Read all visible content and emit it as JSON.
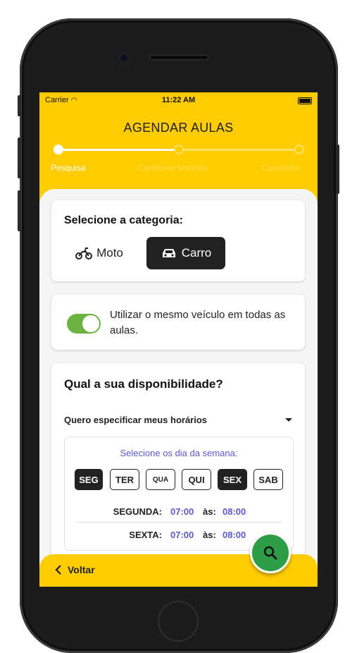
{
  "status_bar": {
    "carrier": "Carrier",
    "time": "11:22 AM"
  },
  "header": {
    "title": "AGENDAR AULAS"
  },
  "stepper": {
    "steps": [
      {
        "label": "Pesquisa",
        "active": true
      },
      {
        "label": "Confirmar horários",
        "active": false
      },
      {
        "label": "Concluído",
        "active": false
      }
    ]
  },
  "category": {
    "title": "Selecione a categoria:",
    "options": [
      {
        "label": "Moto",
        "icon": "motorcycle-icon",
        "selected": false
      },
      {
        "label": "Carro",
        "icon": "car-icon",
        "selected": true
      }
    ]
  },
  "same_vehicle": {
    "text": "Utilizar o mesmo veículo em todas as aulas.",
    "enabled": true
  },
  "availability": {
    "title": "Qual a sua disponibilidade?",
    "mode": "Quero especificar meus horários",
    "weekday_prompt": "Selecione os dia da semana:",
    "days": [
      {
        "label": "SEG",
        "selected": true
      },
      {
        "label": "TER",
        "selected": false
      },
      {
        "label": "QUA",
        "selected": false
      },
      {
        "label": "QUI",
        "selected": false
      },
      {
        "label": "SEX",
        "selected": true
      },
      {
        "label": "SAB",
        "selected": false
      }
    ],
    "schedule": [
      {
        "day": "SEGUNDA:",
        "start": "07:00",
        "sep": "às:",
        "end": "08:00"
      },
      {
        "day": "SEXTA:",
        "start": "07:00",
        "sep": "às:",
        "end": "08:00"
      }
    ]
  },
  "footer": {
    "back_label": "Voltar"
  },
  "colors": {
    "accent": "#ffcc00",
    "dark": "#222222",
    "toggle_on": "#6cb33f",
    "fab": "#2e9e46",
    "link": "#5a5acc"
  }
}
